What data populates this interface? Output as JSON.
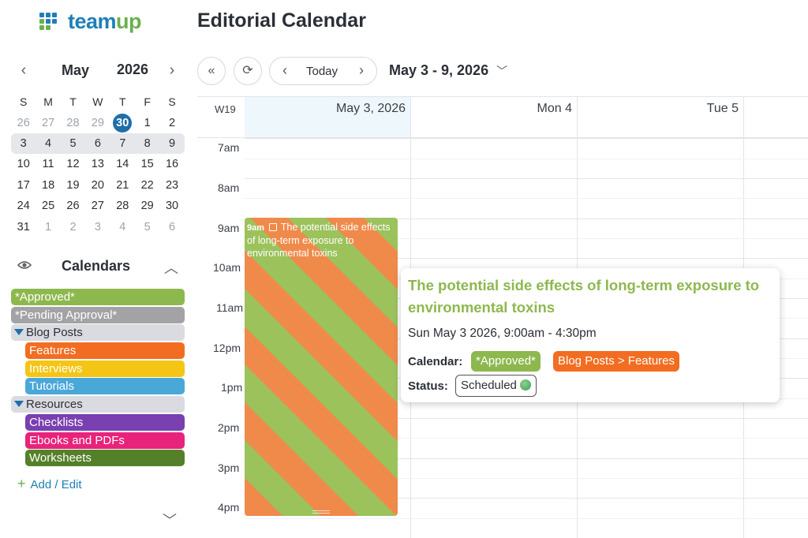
{
  "app": {
    "logo_text_a": "team",
    "logo_text_b": "up",
    "page_title": "Editorial Calendar"
  },
  "mini_calendar": {
    "month": "May",
    "year": "2026",
    "weekdays": [
      "S",
      "M",
      "T",
      "W",
      "T",
      "F",
      "S"
    ],
    "weeks": [
      [
        "26",
        "27",
        "28",
        "29",
        "30",
        "1",
        "2"
      ],
      [
        "3",
        "4",
        "5",
        "6",
        "7",
        "8",
        "9"
      ],
      [
        "10",
        "11",
        "12",
        "13",
        "14",
        "15",
        "16"
      ],
      [
        "17",
        "18",
        "19",
        "20",
        "21",
        "22",
        "23"
      ],
      [
        "24",
        "25",
        "26",
        "27",
        "28",
        "29",
        "30"
      ],
      [
        "31",
        "1",
        "2",
        "3",
        "4",
        "5",
        "6"
      ]
    ]
  },
  "calendars": {
    "header": "Calendars",
    "items": [
      {
        "label": "*Approved*",
        "color": "#8db84e"
      },
      {
        "label": "*Pending Approval*",
        "color": "#a3a3a6"
      },
      {
        "label": "Blog Posts",
        "color": "#d9dbe0"
      },
      {
        "label": "Features",
        "color": "#f26d21"
      },
      {
        "label": "Interviews",
        "color": "#f5c516"
      },
      {
        "label": "Tutorials",
        "color": "#4aa8d8"
      },
      {
        "label": "Resources",
        "color": "#d9dbe0"
      },
      {
        "label": "Checklists",
        "color": "#7a3fb0"
      },
      {
        "label": "Ebooks and PDFs",
        "color": "#e8237b"
      },
      {
        "label": "Worksheets",
        "color": "#55802a"
      }
    ],
    "add_edit": "Add / Edit"
  },
  "toolbar": {
    "today": "Today",
    "range": "May 3 - 9, 2026"
  },
  "grid": {
    "week_number": "W19",
    "columns": [
      "May 3, 2026",
      "Mon 4",
      "Tue 5"
    ],
    "hours": [
      "7am",
      "8am",
      "9am",
      "10am",
      "11am",
      "12pm",
      "1pm",
      "2pm",
      "3pm",
      "4pm"
    ]
  },
  "event": {
    "time": "9am",
    "title": "The potential side effects of long-term exposure to environmental toxins",
    "colors": [
      "#f08a4b",
      "#9cc25c"
    ]
  },
  "popup": {
    "title": "The potential side effects of long-term exposure to environmental toxins",
    "datetime": "Sun May 3 2026, 9:00am - 4:30pm",
    "calendar_label": "Calendar:",
    "calendar_tag_1": "*Approved*",
    "calendar_tag_2": "Blog Posts > Features",
    "status_label": "Status:",
    "status_value": "Scheduled"
  },
  "colors": {
    "brand_blue": "#1e7fb8",
    "brand_green": "#6ab04c",
    "today_highlight": "#1e6fa8"
  }
}
